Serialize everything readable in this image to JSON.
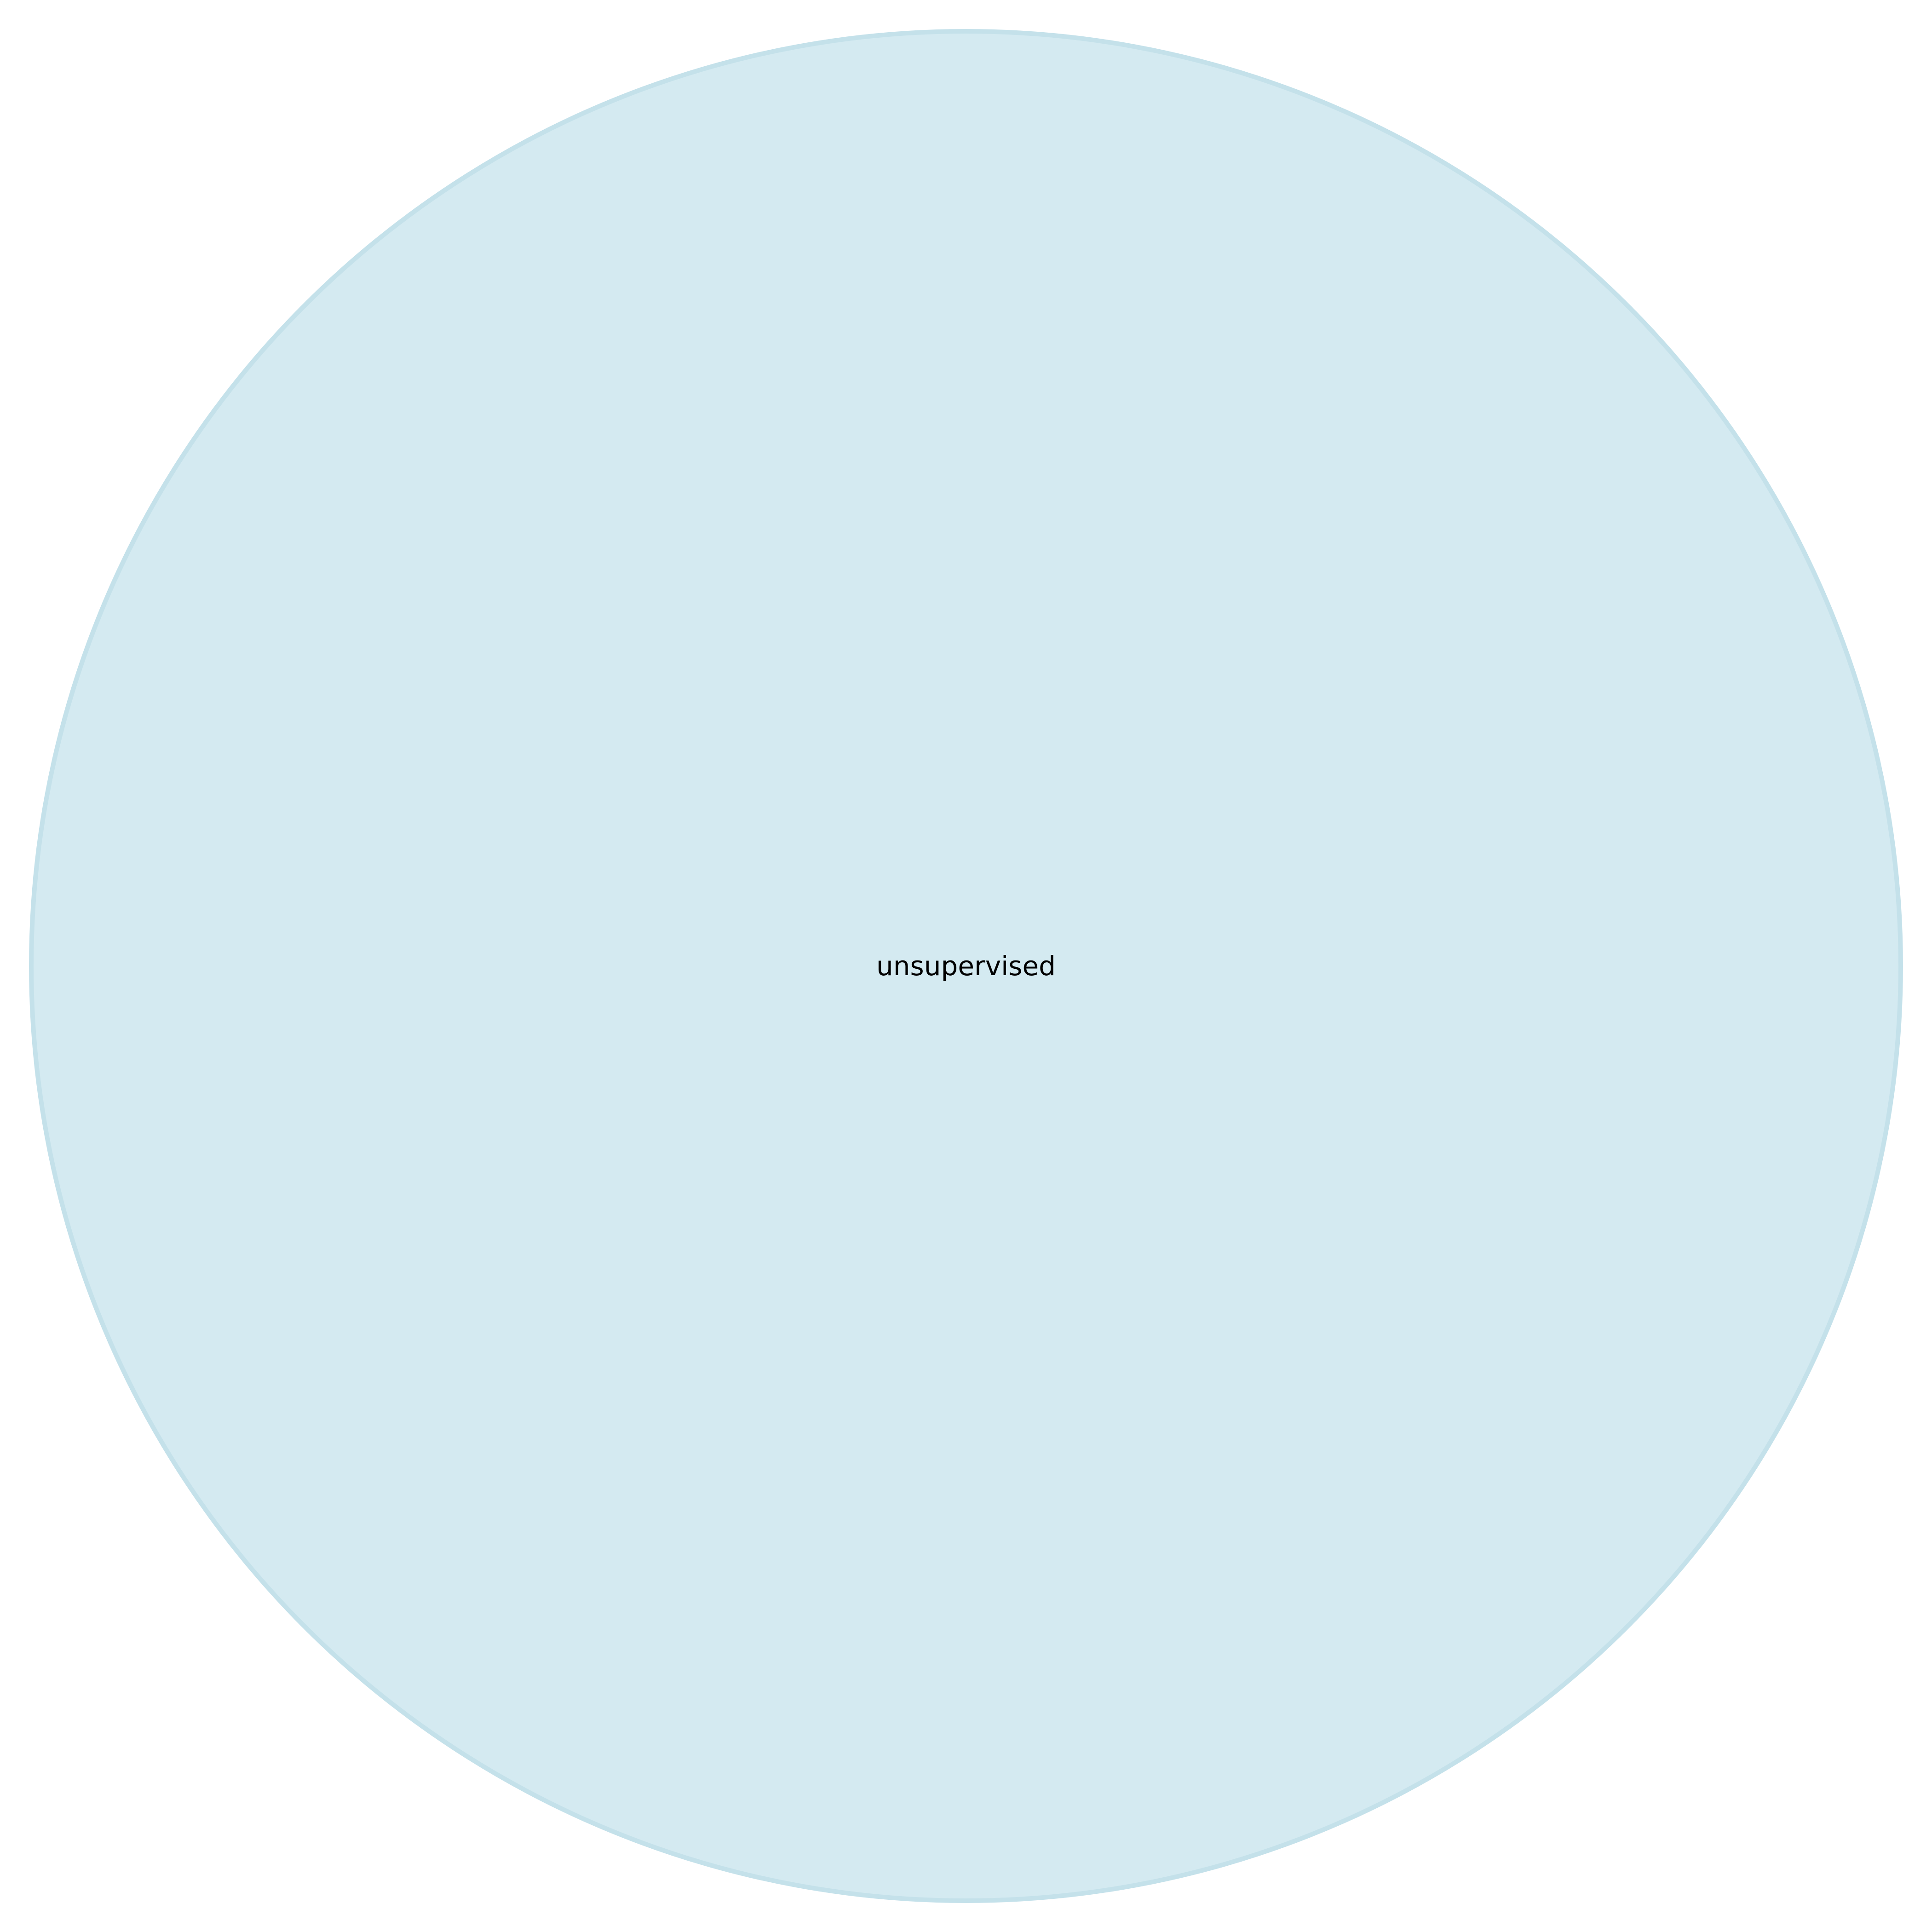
{
  "diagram": {
    "nodes": [
      {
        "id": "unsupervised",
        "label": "unsupervised",
        "fill": "#d4eaf1",
        "stroke": "#c4e1ea",
        "text_color": "#000000"
      }
    ]
  }
}
